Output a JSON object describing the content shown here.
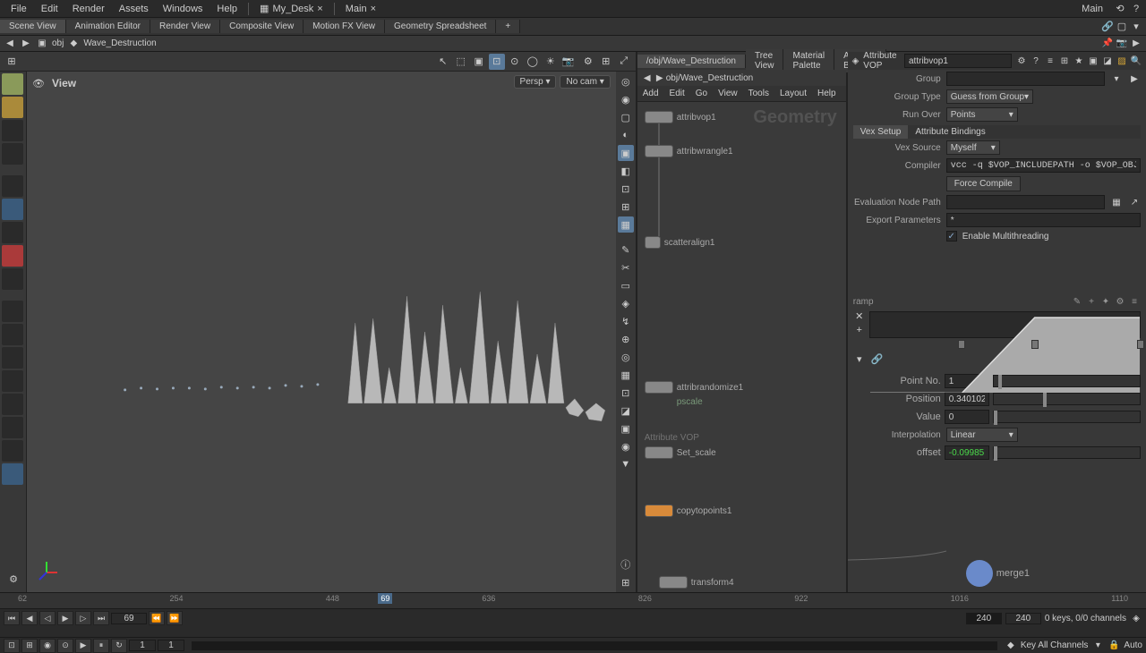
{
  "topmenu": {
    "file": "File",
    "edit": "Edit",
    "render": "Render",
    "assets": "Assets",
    "windows": "Windows",
    "help": "Help"
  },
  "desk": {
    "name": "My_Desk",
    "main": "Main",
    "main2": "Main"
  },
  "panetabs": {
    "scene": "Scene View",
    "anim": "Animation Editor",
    "render": "Render View",
    "composite": "Composite View",
    "motionfx": "Motion FX View",
    "geosheet": "Geometry Spreadsheet",
    "plus": "+"
  },
  "path": {
    "obj": "obj",
    "network": "Wave_Destruction"
  },
  "viewport": {
    "label": "View",
    "persp": "Persp",
    "nocam": "No cam"
  },
  "network": {
    "path_full": "/obj/Wave_Destruction",
    "tabs": {
      "tree": "Tree View",
      "material": "Material Palette",
      "asset": "Asset Browser",
      "plus": "+"
    },
    "menu": {
      "add": "Add",
      "edit": "Edit",
      "go": "Go",
      "view": "View",
      "tools": "Tools",
      "layout": "Layout",
      "help": "Help"
    },
    "nodes": {
      "attribvop1": "attribvop1",
      "attribwrangle1": "attribwrangle1",
      "scatteralign1": "scatteralign1",
      "attribrandomize1": "attribrandomize1",
      "pscale": "pscale",
      "attribvop_type": "Attribute VOP",
      "set_scale": "Set_scale",
      "copytopoints1": "copytopoints1",
      "transform4": "transform4",
      "merge1": "merge1"
    }
  },
  "params": {
    "node_type": "Attribute VOP",
    "node_name": "attribvop1",
    "group_label": "Group",
    "group_type_label": "Group Type",
    "group_type": "Guess from Group",
    "run_over_label": "Run Over",
    "run_over": "Points",
    "tab_vex": "Vex Setup",
    "tab_attr": "Attribute Bindings",
    "vex_source_label": "Vex Source",
    "vex_source": "Myself",
    "compiler_label": "Compiler",
    "compiler": "vcc -q $VOP_INCLUDEPATH -o $VOP_OBJECTFILE -e",
    "force_compile": "Force Compile",
    "eval_path_label": "Evaluation Node Path",
    "export_params_label": "Export Parameters",
    "export_params": "*",
    "enable_multi": "Enable Multithreading",
    "ramp_label": "ramp",
    "point_no_label": "Point No.",
    "point_no": "1",
    "position_label": "Position",
    "position": "0.340102",
    "value_label": "Value",
    "value": "0",
    "interp_label": "Interpolation",
    "interp": "Linear",
    "offset_label": "offset",
    "offset": "-0.0998519"
  },
  "chart_data": {
    "type": "line",
    "title": "ramp",
    "xlabel": "",
    "ylabel": "",
    "xlim": [
      0,
      1
    ],
    "ylim": [
      0,
      1
    ],
    "series": [
      {
        "name": "ramp",
        "x": [
          0,
          0.34,
          0.61,
          1.0
        ],
        "y": [
          0,
          0,
          1.0,
          1.0
        ]
      }
    ],
    "handles": [
      0.34,
      0.61,
      1.0
    ],
    "interpolation": "Linear"
  },
  "timeline": {
    "ticks": [
      "62",
      "254",
      "448",
      "636",
      "826",
      "922",
      "1016",
      "1110"
    ],
    "current": "69",
    "start": "1",
    "end": "240",
    "range_start": "1",
    "range_end": "240",
    "keys_status": "0 keys, 0/0 channels",
    "key_all": "Key All Channels",
    "auto": "Auto"
  },
  "overlay": {
    "geometry": "Geometry"
  }
}
